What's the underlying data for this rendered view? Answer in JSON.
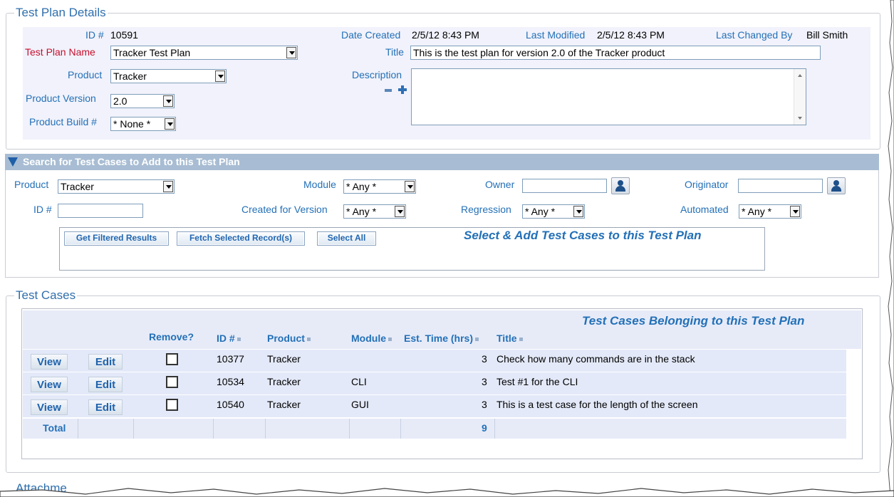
{
  "plan_details": {
    "legend": "Test Plan Details",
    "id_label": "ID #",
    "id_value": "10591",
    "date_created_label": "Date Created",
    "date_created_value": "2/5/12 8:43 PM",
    "last_modified_label": "Last Modified",
    "last_modified_value": "2/5/12 8:43 PM",
    "last_changed_by_label": "Last Changed By",
    "last_changed_by_value": "Bill Smith",
    "name_label": "Test Plan Name",
    "name_value": "Tracker Test Plan",
    "title_label": "Title",
    "title_value": "This is the test plan for version 2.0 of the Tracker product",
    "product_label": "Product",
    "product_value": "Tracker",
    "description_label": "Description",
    "description_value": "",
    "version_label": "Product Version",
    "version_value": "2.0",
    "build_label": "Product Build #",
    "build_value": "* None *"
  },
  "search": {
    "header": "Search for Test Cases to Add to this Test Plan",
    "product_label": "Product",
    "product_value": "Tracker",
    "module_label": "Module",
    "module_value": "* Any *",
    "owner_label": "Owner",
    "owner_value": "",
    "originator_label": "Originator",
    "originator_value": "",
    "id_label": "ID #",
    "id_value": "",
    "created_for_label": "Created for Version",
    "created_for_value": "* Any *",
    "regression_label": "Regression",
    "regression_value": "* Any *",
    "automated_label": "Automated",
    "automated_value": "* Any *",
    "btn_filtered": "Get Filtered Results",
    "btn_fetch": "Fetch Selected Record(s)",
    "btn_select_all": "Select All",
    "results_title": "Select & Add Test Cases to this Test Plan"
  },
  "test_cases": {
    "legend": "Test Cases",
    "caption": "Test Cases Belonging to this Test Plan",
    "headers": {
      "remove": "Remove?",
      "id": "ID #",
      "product": "Product",
      "module": "Module",
      "est_time": "Est. Time (hrs)",
      "title": "Title"
    },
    "rows": [
      {
        "view": "View",
        "edit": "Edit",
        "id": "10377",
        "product": "Tracker",
        "module": "",
        "est": "3",
        "title": "Check how many commands are in the stack"
      },
      {
        "view": "View",
        "edit": "Edit",
        "id": "10534",
        "product": "Tracker",
        "module": "CLI",
        "est": "3",
        "title": "Test #1 for the CLI"
      },
      {
        "view": "View",
        "edit": "Edit",
        "id": "10540",
        "product": "Tracker",
        "module": "GUI",
        "est": "3",
        "title": "This is a test case for the length of the screen"
      }
    ],
    "total_label": "Total",
    "total_value": "9"
  },
  "attachments": {
    "legend": "Attachme"
  },
  "colors": {
    "accent": "#2370b7",
    "required": "#c8102e",
    "section_header": "#a6bcd3",
    "row_bg": "#e3e9f8"
  },
  "icons": [
    "user-icon",
    "expand-icon",
    "collapse-icon",
    "triangle-down-icon",
    "sort-icon"
  ]
}
